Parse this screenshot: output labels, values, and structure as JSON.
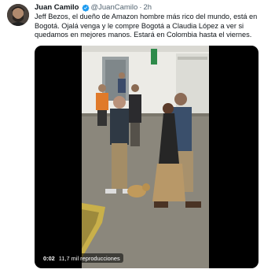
{
  "author": {
    "name": "Juan Camilo",
    "handle": "@JuanCamilo",
    "separator": "·",
    "time": "2h"
  },
  "tweet": {
    "text": "Jeff Bezos, el dueño de Amazon hombre más rico del mundo, está en Bogotá. Ojalá venga y le compre Bogotá a Claudia López a ver si quedamos en mejores manos. Estará en Colombia hasta el viernes."
  },
  "video": {
    "duration": "0:02",
    "views": "11,7 mil reproducciones"
  },
  "icons": {
    "verified": "verified-badge-icon"
  },
  "colors": {
    "verified_blue": "#1d9bf0",
    "text_primary": "#0f1419",
    "text_secondary": "#536471"
  }
}
